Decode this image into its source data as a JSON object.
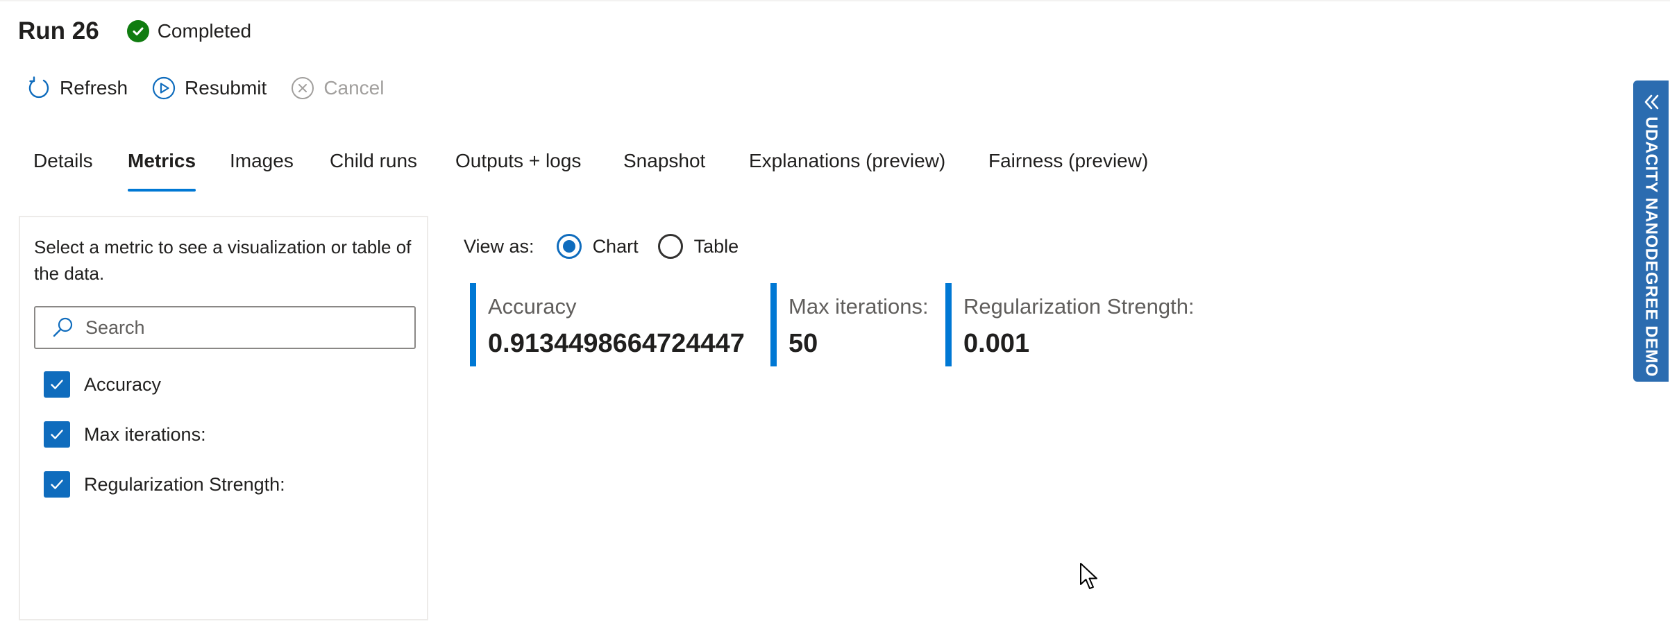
{
  "header": {
    "title": "Run 26",
    "status": "Completed",
    "status_color": "#107c10"
  },
  "toolbar": {
    "refresh_label": "Refresh",
    "resubmit_label": "Resubmit",
    "cancel_label": "Cancel"
  },
  "tabs": [
    {
      "label": "Details",
      "active": false
    },
    {
      "label": "Metrics",
      "active": true
    },
    {
      "label": "Images",
      "active": false
    },
    {
      "label": "Child runs",
      "active": false
    },
    {
      "label": "Outputs + logs",
      "active": false
    },
    {
      "label": "Snapshot",
      "active": false
    },
    {
      "label": "Explanations (preview)",
      "active": false
    },
    {
      "label": "Fairness (preview)",
      "active": false
    }
  ],
  "left_panel": {
    "hint": "Select a metric to see a visualization or table of the data.",
    "search": {
      "placeholder": "Search",
      "value": ""
    },
    "metrics": [
      {
        "label": "Accuracy",
        "checked": true
      },
      {
        "label": "Max iterations:",
        "checked": true
      },
      {
        "label": "Regularization Strength:",
        "checked": true
      }
    ]
  },
  "view_as": {
    "label": "View as:",
    "options": [
      {
        "label": "Chart",
        "selected": true
      },
      {
        "label": "Table",
        "selected": false
      }
    ]
  },
  "metric_cards": [
    {
      "name": "Accuracy",
      "value": "0.9134498664724447"
    },
    {
      "name": "Max iterations:",
      "value": "50"
    },
    {
      "name": "Regularization Strength:",
      "value": "0.001"
    }
  ],
  "side_tab": {
    "label": "UDACITY NANODEGREE DEMO",
    "icon": "double-chevron-left-icon",
    "background": "#2b6cb0"
  },
  "colors": {
    "accent": "#0078d4",
    "checkbox": "#0f6cbd"
  }
}
